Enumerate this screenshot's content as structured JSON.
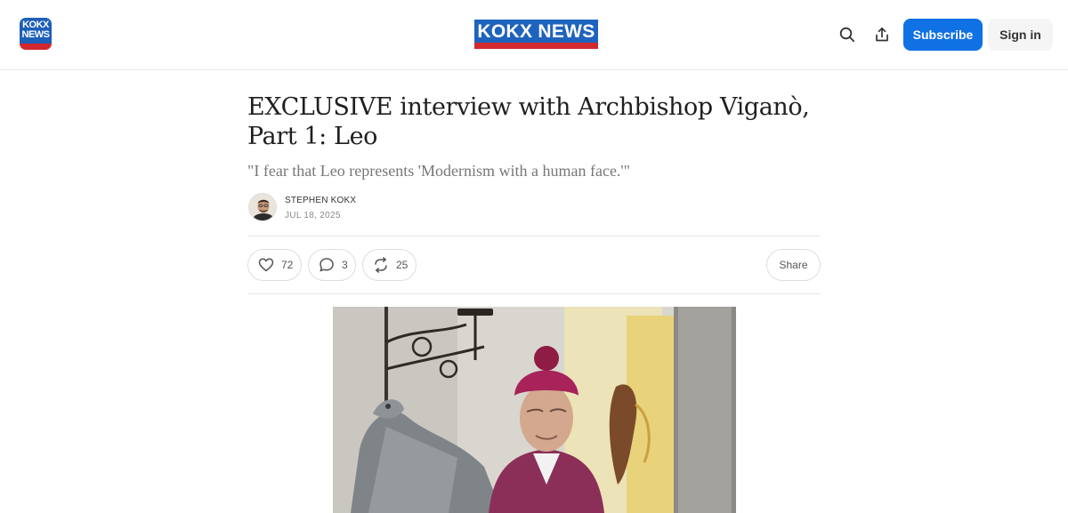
{
  "header": {
    "small_logo_text": "KOKX\nNEWS",
    "center_logo_text": "KOKX NEWS",
    "subscribe_label": "Subscribe",
    "signin_label": "Sign in",
    "icons": [
      "search-icon",
      "share-upload-icon"
    ],
    "brand_colors": {
      "blue": "#1e63bd",
      "red": "#d42a2f",
      "subscribe": "#1071e5"
    }
  },
  "article": {
    "title": "EXCLUSIVE interview with Archbishop Viganò, Part 1: Leo",
    "subtitle": "\"I fear that Leo represents 'Modernism with a human face.'\"",
    "author": "STEPHEN KOKX",
    "date": "JUL 18, 2025"
  },
  "actions": {
    "likes": "72",
    "comments": "3",
    "restacks": "25",
    "share_label": "Share",
    "icons": [
      "heart-icon",
      "comment-icon",
      "restack-icon"
    ]
  }
}
